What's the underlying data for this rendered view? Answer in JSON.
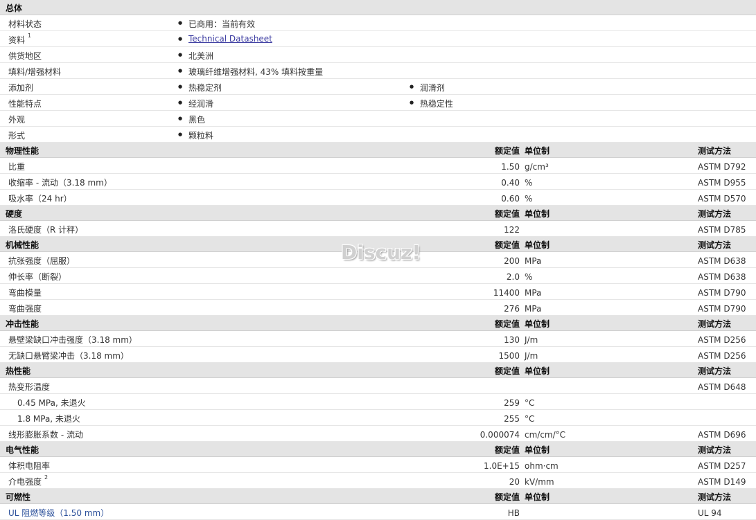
{
  "general": {
    "title": "总体",
    "rows": [
      {
        "label": "材料状态",
        "values": [
          "已商用：当前有效"
        ]
      },
      {
        "label": "资料",
        "sup": "1",
        "values": [
          "Technical Datasheet"
        ],
        "link": true
      },
      {
        "label": "供货地区",
        "values": [
          "北美洲"
        ]
      },
      {
        "label": "填料/增强材料",
        "values": [
          "玻璃纤维增强材料, 43% 填料按重量"
        ]
      },
      {
        "label": "添加剂",
        "values": [
          "热稳定剂",
          "润滑剂"
        ]
      },
      {
        "label": "性能特点",
        "values": [
          "经润滑",
          "热稳定性"
        ]
      },
      {
        "label": "外观",
        "values": [
          "黑色"
        ]
      },
      {
        "label": "形式",
        "values": [
          "颗粒料"
        ]
      }
    ]
  },
  "col_headers": {
    "nominal": "额定值",
    "unit": "单位制",
    "method": "测试方法"
  },
  "sections": [
    {
      "title": "物理性能",
      "rows": [
        {
          "label": "比重",
          "value": "1.50",
          "unit": "g/cm³",
          "method": "ASTM D792"
        },
        {
          "label": "收缩率  - 流动（3.18 mm）",
          "value": "0.40",
          "unit": "%",
          "method": "ASTM D955"
        },
        {
          "label": "吸水率（24 hr）",
          "value": "0.60",
          "unit": "%",
          "method": "ASTM D570"
        }
      ]
    },
    {
      "title": "硬度",
      "rows": [
        {
          "label": "洛氏硬度（R 计秤）",
          "value": "122",
          "unit": "",
          "method": "ASTM D785"
        }
      ]
    },
    {
      "title": "机械性能",
      "rows": [
        {
          "label": "抗张强度（屈服）",
          "value": "200",
          "unit": "MPa",
          "method": "ASTM D638"
        },
        {
          "label": "伸长率（断裂）",
          "value": "2.0",
          "unit": "%",
          "method": "ASTM D638"
        },
        {
          "label": "弯曲模量",
          "value": "11400",
          "unit": "MPa",
          "method": "ASTM D790"
        },
        {
          "label": "弯曲强度",
          "value": "276",
          "unit": "MPa",
          "method": "ASTM D790"
        }
      ]
    },
    {
      "title": "冲击性能",
      "rows": [
        {
          "label": "悬壁梁缺口冲击强度（3.18 mm）",
          "value": "130",
          "unit": "J/m",
          "method": "ASTM D256"
        },
        {
          "label": "无缺口悬臂梁冲击（3.18 mm）",
          "value": "1500",
          "unit": "J/m",
          "method": "ASTM D256"
        }
      ]
    },
    {
      "title": "热性能",
      "rows": [
        {
          "label": "热变形温度",
          "value": "",
          "unit": "",
          "method": "ASTM D648"
        },
        {
          "label": "0.45 MPa, 未退火",
          "sub": true,
          "value": "259",
          "unit": "°C",
          "method": ""
        },
        {
          "label": "1.8 MPa, 未退火",
          "sub": true,
          "value": "255",
          "unit": "°C",
          "method": ""
        },
        {
          "label": "线形膨胀系数  - 流动",
          "value": "0.000074",
          "unit": "cm/cm/°C",
          "method": "ASTM D696"
        }
      ]
    },
    {
      "title": "电气性能",
      "rows": [
        {
          "label": "体积电阻率",
          "value": "1.0E+15",
          "unit": "ohm·cm",
          "method": "ASTM D257"
        },
        {
          "label": "介电强度",
          "sup": "2",
          "value": "20",
          "unit": "kV/mm",
          "method": "ASTM D149"
        }
      ]
    },
    {
      "title": "可燃性",
      "rows": [
        {
          "label": "UL 阻燃等级（1.50 mm）",
          "blue": true,
          "value": "HB",
          "unit": "",
          "method": "UL 94"
        }
      ]
    }
  ],
  "watermark": "Discuz!"
}
